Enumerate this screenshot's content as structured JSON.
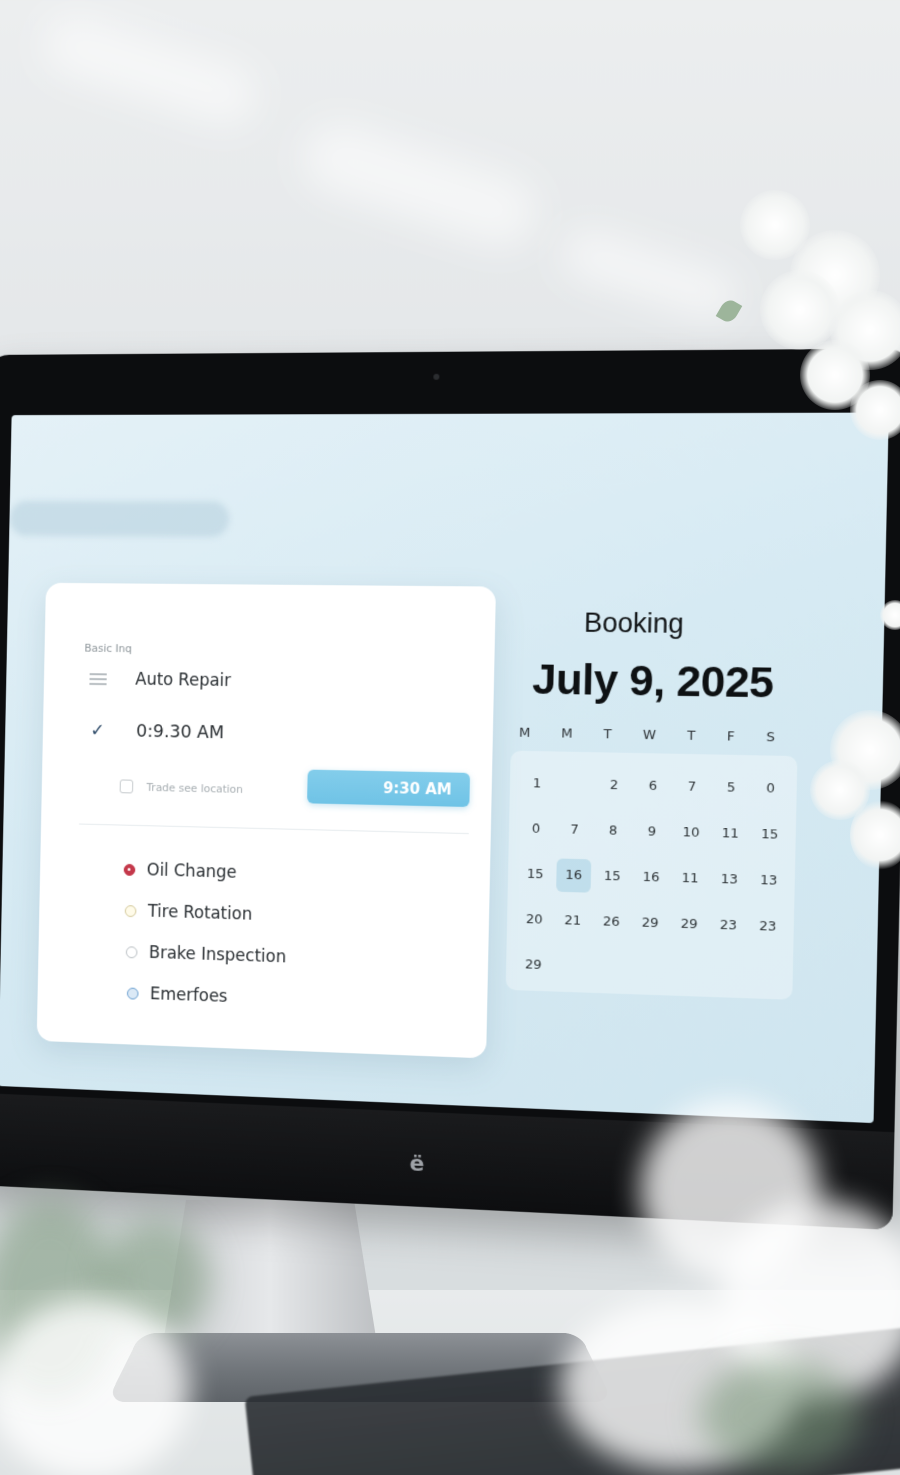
{
  "card": {
    "label": "Basic Inq",
    "service": "Auto Repair",
    "time_value": "0:9.30 AM",
    "note_placeholder": "Trade see location",
    "time_button": "9:30 AM",
    "options": [
      {
        "label": "Oil Change",
        "state": "selected-red"
      },
      {
        "label": "Tire Rotation",
        "state": "unselected-yellow"
      },
      {
        "label": "Brake Inspection",
        "state": "unselected"
      },
      {
        "label": "Emerfoes",
        "state": "selected-blue"
      }
    ]
  },
  "calendar": {
    "title": "Booking",
    "date": "July 9, 2025",
    "weekdays": [
      "M",
      "M",
      "T",
      "W",
      "T",
      "F",
      "S"
    ],
    "days": [
      [
        "1",
        "",
        "2",
        "6",
        "7",
        "5",
        "0"
      ],
      [
        "0",
        "7",
        "8",
        "9",
        "10",
        "11",
        "15"
      ],
      [
        "15",
        "16",
        "15",
        "16",
        "11",
        "13",
        "13"
      ],
      [
        "20",
        "21",
        "26",
        "29",
        "29",
        "23",
        "23"
      ],
      [
        "29",
        "",
        "",
        "",
        "",
        "",
        ""
      ]
    ],
    "selected_day": "16"
  },
  "monitor": {
    "logo": "ë"
  },
  "colors": {
    "accent": "#6fc3e6",
    "screen_bg": "#d6eaf3",
    "oil_radio": "#c4384a",
    "ext_radio": "#6a9fd0"
  }
}
